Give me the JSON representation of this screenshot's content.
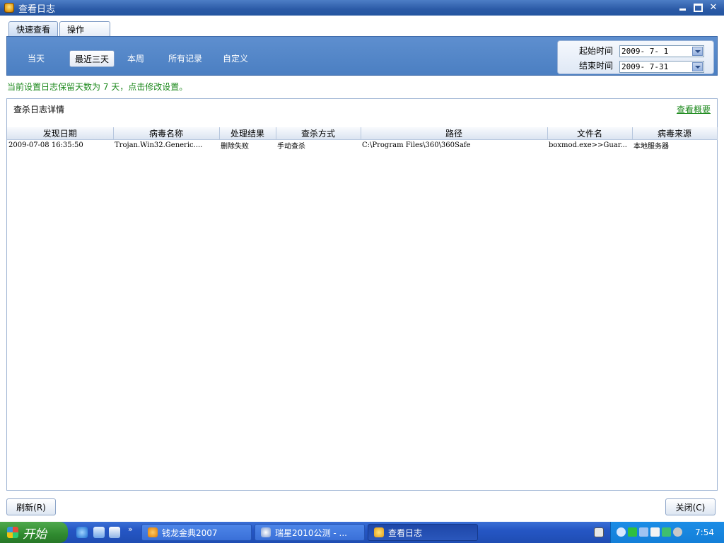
{
  "window": {
    "title": "查看日志",
    "icon": "antivirus-shield-icon"
  },
  "tabs": [
    {
      "label": "快速查看",
      "active": true
    },
    {
      "label": "操作",
      "active": false
    }
  ],
  "quick_filters": {
    "items": [
      "当天",
      "最近三天",
      "本周",
      "所有记录",
      "自定义"
    ],
    "selected": "最近三天"
  },
  "date_range": {
    "start_label": "起始时间",
    "start_value": "2009- 7- 1",
    "end_label": "结束时间",
    "end_value": "2009- 7-31"
  },
  "notice": "当前设置日志保留天数为 7 天，点击修改设置。",
  "panel": {
    "title": "查杀日志详情",
    "summary_link": "查看概要"
  },
  "table": {
    "columns": [
      "发现日期",
      "病毒名称",
      "处理结果",
      "查杀方式",
      "路径",
      "文件名",
      "病毒来源"
    ],
    "rows": [
      [
        "2009-07-08 16:35:50",
        "Trojan.Win32.Generic....",
        "删除失败",
        "手动查杀",
        "C:\\Program Files\\360\\360Safe",
        "boxmod.exe>>Guar...",
        "本地服务器"
      ]
    ]
  },
  "buttons": {
    "refresh": "刷新(R)",
    "close": "关闭(C)"
  },
  "taskbar": {
    "start_label": "开始",
    "tasks": [
      {
        "label": "钱龙金典2007",
        "active": false
      },
      {
        "label": "瑞星2010公测 - ...",
        "active": false
      },
      {
        "label": "查看日志",
        "active": true
      }
    ],
    "clock": "7:54"
  },
  "colors": {
    "title_bar": "#2b5aa6",
    "panel_blue": "#5e8fcf",
    "notice_green": "#1e8a1e",
    "taskbar": "#2556c4"
  }
}
